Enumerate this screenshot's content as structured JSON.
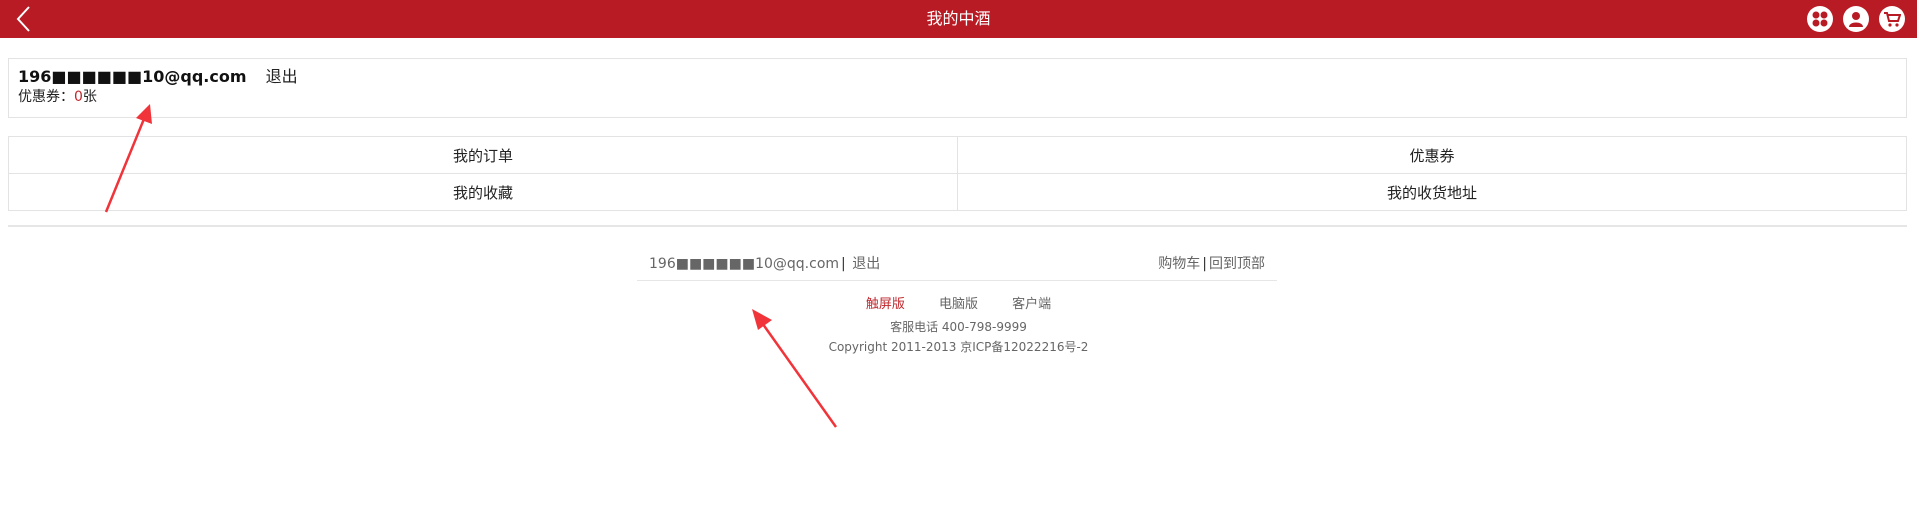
{
  "header": {
    "title": "我的中酒",
    "back_icon": "chevron-left-icon",
    "icons": [
      "apps-icon",
      "user-icon",
      "cart-icon"
    ],
    "bg_color": "#b91b24"
  },
  "account": {
    "email": "196■■■■■■10@qq.com",
    "logout": "退出",
    "coupon_label": "优惠券：",
    "coupon_count": "0",
    "coupon_unit": "张"
  },
  "menu": {
    "orders": "我的订单",
    "coupons": "优惠券",
    "favorites": "我的收藏",
    "addresses": "我的收货地址"
  },
  "footer": {
    "email": "196■■■■■■10@qq.com",
    "sep": "|",
    "logout": "退出",
    "cart": "购物车",
    "back_to_top": "回到顶部",
    "touch_version": "触屏版",
    "pc_version": "电脑版",
    "client": "客户端",
    "hotline": "客服电话 400-798-9999",
    "copyright": "Copyright 2011-2013 京ICP备12022216号-2"
  },
  "colors": {
    "accent": "#c0272d",
    "annotation_arrow": "#f0343a"
  }
}
